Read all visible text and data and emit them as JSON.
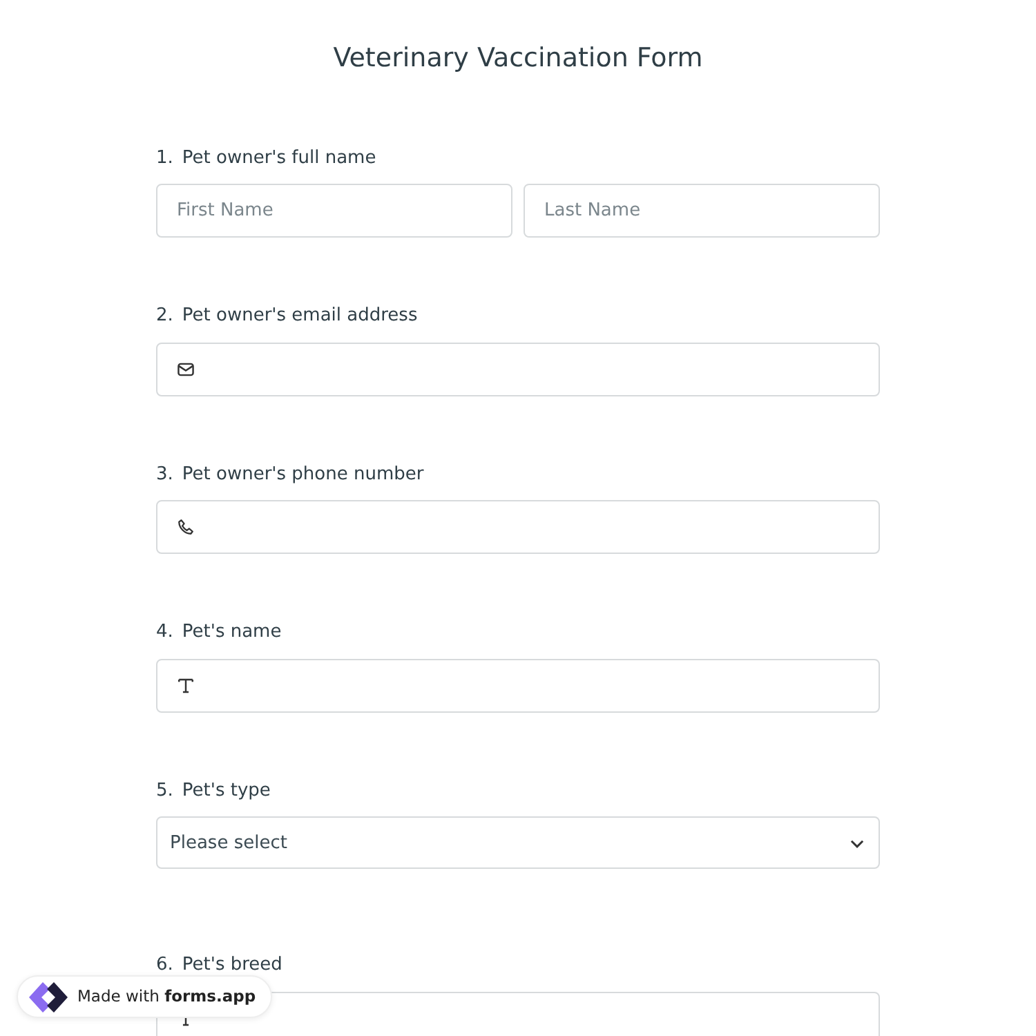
{
  "title": "Veterinary Vaccination Form",
  "questions": [
    {
      "number": "1.",
      "label": "Pet owner's full name",
      "kind": "name",
      "placeholders": [
        "First Name",
        "Last Name"
      ]
    },
    {
      "number": "2.",
      "label": "Pet owner's email address",
      "kind": "email"
    },
    {
      "number": "3.",
      "label": "Pet owner's phone number",
      "kind": "phone"
    },
    {
      "number": "4.",
      "label": "Pet's name",
      "kind": "text"
    },
    {
      "number": "5.",
      "label": "Pet's type",
      "kind": "select",
      "value": "Please select"
    },
    {
      "number": "6.",
      "label": "Pet's breed",
      "kind": "text"
    }
  ],
  "badge": {
    "text": "Made with **forms.app**"
  }
}
